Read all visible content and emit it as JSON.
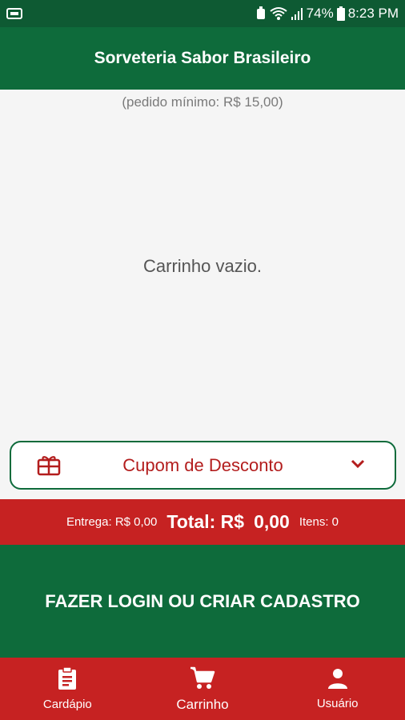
{
  "status_bar": {
    "battery": "74%",
    "time": "8:23 PM",
    "icons": [
      "notification-icon",
      "alarm-icon",
      "wifi-icon",
      "signal-icon",
      "battery-icon"
    ]
  },
  "app_bar": {
    "title": "Sorveteria Sabor Brasileiro"
  },
  "cart": {
    "minimum_order": "(pedido mínimo: R$ 15,00)",
    "empty_message": "Carrinho vazio."
  },
  "coupon": {
    "label": "Cupom de Desconto",
    "icon": "gift-card-icon",
    "expand_icon": "chevron-down-icon"
  },
  "totals": {
    "delivery": "Entrega: R$ 0,00",
    "total_label": "Total: R$",
    "total_value": "0,00",
    "items": "Itens: 0"
  },
  "login": {
    "label": "FAZER LOGIN OU CRIAR CADASTRO"
  },
  "bottom_nav": {
    "items": [
      {
        "label": "Cardápio",
        "icon": "menu-clipboard-icon"
      },
      {
        "label": "Carrinho",
        "icon": "cart-icon",
        "active": true
      },
      {
        "label": "Usuário",
        "icon": "user-icon"
      }
    ]
  },
  "colors": {
    "primary_green": "#0e6b3b",
    "accent_red": "#c62222",
    "coupon_text": "#b31d1d"
  }
}
